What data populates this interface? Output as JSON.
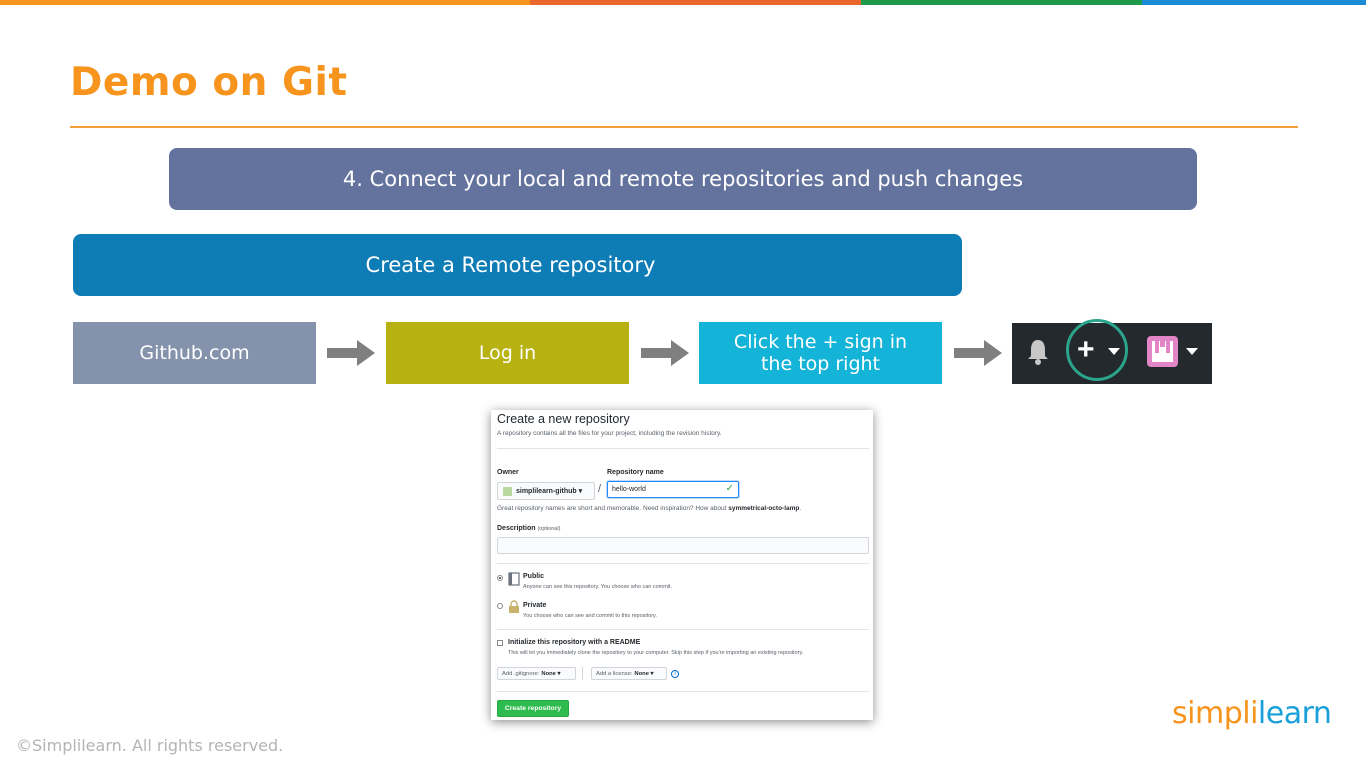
{
  "colors": {
    "top_bar": [
      "#f7941d",
      "#e8672a",
      "#1f9a4b",
      "#1b8bd6"
    ],
    "title": "#f7941d",
    "step_banner": "#64739e",
    "sub_banner": "#0e7cb5",
    "box_github": "#8492ac",
    "box_login": "#b8b112",
    "box_click": "#14b3d8",
    "create_button": "#2ebc4f"
  },
  "slide": {
    "title": "Demo on Git",
    "step_banner": "4. Connect your local and remote repositories and push changes",
    "sub_banner": "Create a Remote repository"
  },
  "flow": {
    "steps": [
      "Github.com",
      "Log in",
      "Click the + sign in the top right"
    ],
    "arrow_icon": "right-arrow-icon",
    "github_header_icons": [
      "bell-icon",
      "plus-icon",
      "caret-down-icon",
      "avatar-icon",
      "caret-down-icon"
    ],
    "plus_symbol": "+"
  },
  "form": {
    "title": "Create a new repository",
    "subtitle": "A repository contains all the files for your project, including the revision history.",
    "owner_label": "Owner",
    "owner_value": "simplilearn-github",
    "owner_caret": "▾",
    "slash": "/",
    "repo_label": "Repository name",
    "repo_value": "hello-world",
    "repo_check": "✓",
    "hint_prefix": "Great repository names are short and memorable. Need inspiration? How about ",
    "hint_suggestion": "symmetrical-octo-lamp",
    "hint_suffix": ".",
    "description_label": "Description",
    "description_optional": "(optional)",
    "public_title": "Public",
    "public_sub": "Anyone can see this repository. You choose who can commit.",
    "private_title": "Private",
    "private_sub": "You choose who can see and commit to this repository.",
    "readme_title": "Initialize this repository with a README",
    "readme_sub": "This will let you immediately clone the repository to your computer. Skip this step if you're importing an existing repository.",
    "gitignore_prefix": "Add .gitignore:",
    "gitignore_value": "None ▾",
    "license_prefix": "Add a license:",
    "license_value": "None ▾",
    "info_symbol": "i",
    "create_button": "Create repository",
    "visibility_selected": "Public",
    "readme_checked": false
  },
  "footer": {
    "copyright": "©Simplilearn. All rights reserved.",
    "logo_part1": "simpl",
    "logo_part2": "i",
    "logo_part3": "learn"
  }
}
